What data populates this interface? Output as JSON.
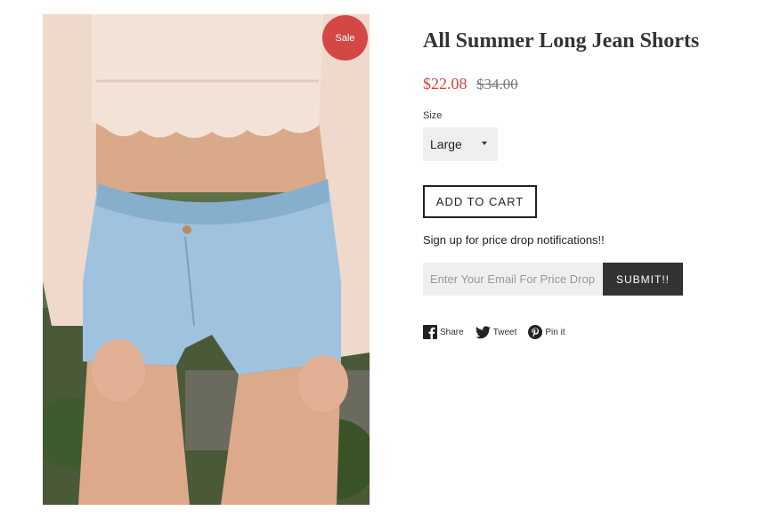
{
  "product": {
    "image_alt": "All Summer Long Jean Shorts",
    "sale_badge": "Sale",
    "title": "All Summer Long Jean Shorts",
    "price_current": "$22.08",
    "price_compare": "$34.00",
    "size_label": "Size",
    "size_selected": "Large",
    "add_to_cart": "ADD TO CART"
  },
  "signup": {
    "text": "Sign up for price drop notifications!!",
    "email_placeholder": "Enter Your Email For Price Drop Notifications",
    "submit": "SUBMIT!!"
  },
  "social": {
    "share": "Share",
    "tweet": "Tweet",
    "pin": "Pin it",
    "share_icon": "facebook-icon",
    "tweet_icon": "twitter-icon",
    "pin_icon": "pinterest-icon"
  },
  "colors": {
    "sale_badge": "#d34745",
    "price_current": "#d0453f",
    "button_dark": "#333333",
    "input_bg": "#efefef"
  }
}
